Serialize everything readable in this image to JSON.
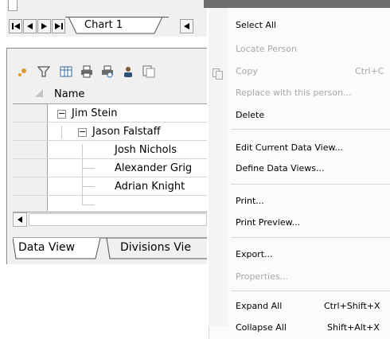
{
  "chart_tabs": {
    "nav_first": "◀▌",
    "nav_prev": "◀",
    "nav_next": "▶",
    "nav_last": "▶▌",
    "active_tab_label": "Chart 1",
    "scroll_left": "◀",
    "top_stub": "-"
  },
  "toolbar": {
    "icons": [
      "expand-icon",
      "filter-icon",
      "grid-settings-icon",
      "print-icon",
      "print-preview-icon",
      "person-icon",
      "copy-icon"
    ]
  },
  "grid": {
    "header_name": "Name",
    "rows": [
      {
        "label": "Jim Stein",
        "expander": "−"
      },
      {
        "label": "Jason Falstaff",
        "expander": "−"
      },
      {
        "label": "Josh Nichols"
      },
      {
        "label": "Alexander Grig"
      },
      {
        "label": "Adrian Knight"
      }
    ],
    "hscroll_left": "◀"
  },
  "bottom_tabs": {
    "tab1": "Data View",
    "tab2": "Divisions Vie"
  },
  "context_menu": {
    "select_all": "Select All",
    "locate_person": "Locate Person",
    "copy": "Copy",
    "copy_shortcut": "Ctrl+C",
    "replace": "Replace with this person...",
    "delete": "Delete",
    "edit_view": "Edit Current Data View...",
    "define_views": "Define Data Views...",
    "print": "Print...",
    "print_preview": "Print Preview...",
    "export": "Export...",
    "properties": "Properties...",
    "expand_all": "Expand All",
    "expand_all_shortcut": "Ctrl+Shift+X",
    "collapse_all": "Collapse All",
    "collapse_all_shortcut": "Shift+Alt+X"
  },
  "colors": {
    "panel_bg": "#f0f0f0",
    "disabled_text": "#a8a8a8",
    "menu_bg": "#fbfbfb"
  }
}
